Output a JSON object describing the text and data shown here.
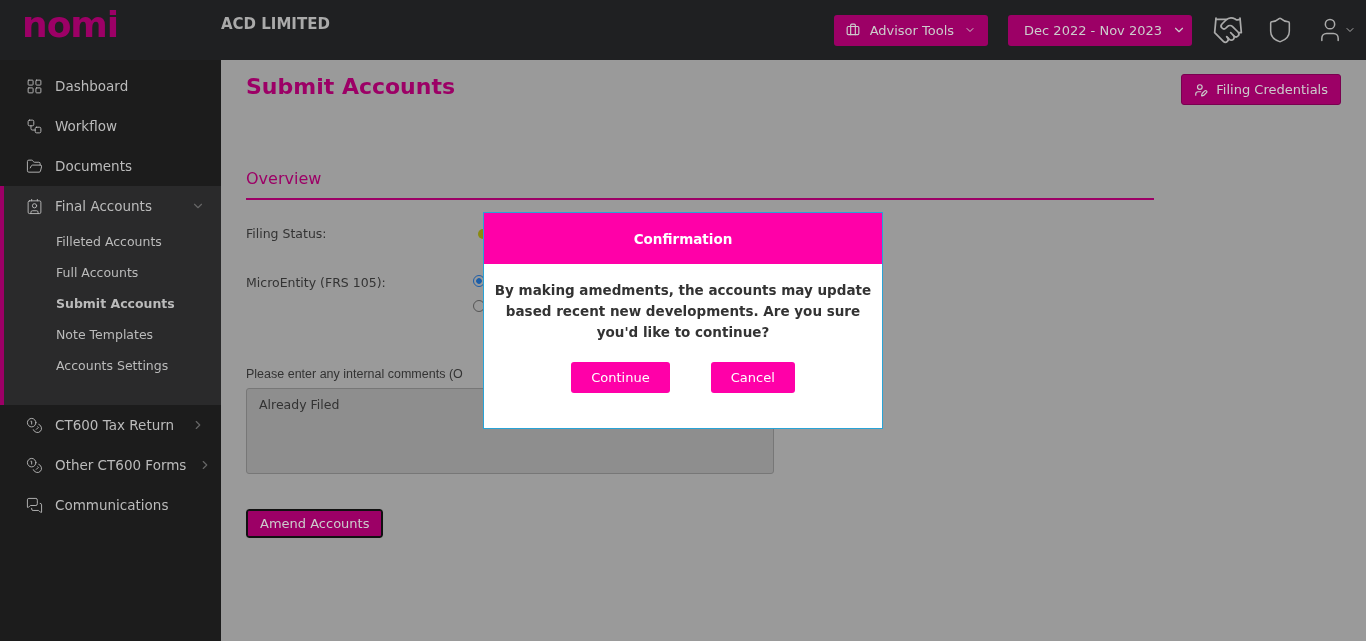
{
  "header": {
    "logo": "nomi",
    "company": "ACD LIMITED",
    "advisor_tools": "Advisor Tools",
    "period": "Dec 2022 - Nov 2023"
  },
  "sidebar": {
    "items": [
      {
        "label": "Dashboard"
      },
      {
        "label": "Workflow"
      },
      {
        "label": "Documents"
      },
      {
        "label": "Final Accounts",
        "expanded": true,
        "children": [
          {
            "label": "Filleted Accounts",
            "selected": false
          },
          {
            "label": "Full Accounts",
            "selected": false
          },
          {
            "label": "Submit Accounts",
            "selected": true
          },
          {
            "label": "Note Templates",
            "selected": false
          },
          {
            "label": "Accounts Settings",
            "selected": false
          }
        ]
      },
      {
        "label": "CT600 Tax Return",
        "expanded": false
      },
      {
        "label": "Other CT600 Forms",
        "expanded": false
      },
      {
        "label": "Communications"
      }
    ]
  },
  "page": {
    "title": "Submit Accounts",
    "filing_credentials": "Filing Credentials",
    "section": "Overview",
    "filing_status_label": "Filing Status:",
    "microentity_label": "MicroEntity (FRS 105):",
    "radios": [
      {
        "selected": true
      },
      {
        "selected": false
      }
    ],
    "comments_label": "Please enter any internal comments (O",
    "comments_value": "Already Filed",
    "amend_button": "Amend Accounts"
  },
  "dialog": {
    "title": "Confirmation",
    "message": "By making amedments, the accounts may update based recent new developments. Are you sure you'd like to continue?",
    "buttons": [
      "Continue",
      "Cancel"
    ]
  }
}
